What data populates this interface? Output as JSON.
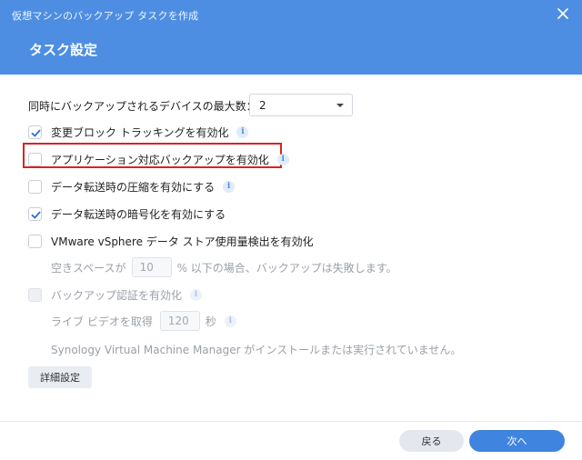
{
  "window": {
    "title": "仮想マシンのバックアップ タスクを作成",
    "section_title": "タスク設定"
  },
  "settings": {
    "max_devices_label": "同時にバックアップされるデバイスの最大数：",
    "max_devices_value": "2",
    "cbt_label": "変更ブロック トラッキングを有効化",
    "cbt_checked": true,
    "app_aware_label": "アプリケーション対応バックアップを有効化",
    "app_aware_checked": false,
    "compression_label": "データ転送時の圧縮を有効にする",
    "compression_checked": false,
    "encryption_label": "データ転送時の暗号化を有効にする",
    "encryption_checked": true,
    "vmware_usage_label": "VMware vSphere データ ストア使用量検出を有効化",
    "vmware_usage_checked": false,
    "free_space_prefix": "空きスペースが",
    "free_space_value": "10",
    "free_space_suffix": "% 以下の場合、バックアップは失敗します。",
    "verify_label": "バックアップ認証を有効化",
    "verify_checked": false,
    "live_video_prefix": "ライブ ビデオを取得",
    "live_video_value": "120",
    "live_video_suffix": "秒",
    "vmm_notice": "Synology Virtual Machine Manager がインストールまたは実行されていません。"
  },
  "buttons": {
    "advanced": "詳細設定",
    "back": "戻る",
    "next": "次へ"
  },
  "icons": {
    "close": "close-icon",
    "info": "info-icon",
    "check": "check-icon",
    "dropdown": "chevron-down-icon"
  },
  "colors": {
    "header": "#4d8ee2",
    "primary_button": "#3f85e0",
    "highlight_border": "#d62424",
    "checkmark": "#2f6fd0"
  }
}
